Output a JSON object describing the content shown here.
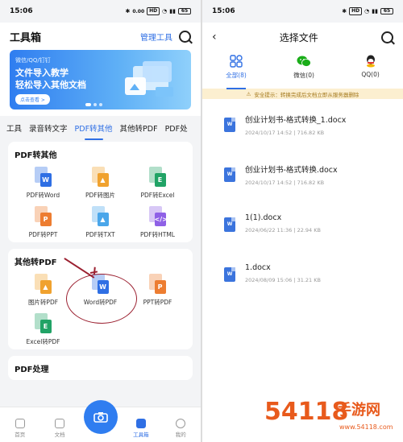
{
  "left": {
    "status": {
      "time": "15:06",
      "speed": "0.00\nKB/s",
      "battery": "65"
    },
    "header": {
      "title": "工具箱",
      "manage": "管理工具"
    },
    "banner": {
      "small": "微信/QQ/钉钉",
      "line1": "文件导入教学",
      "line2": "轻松导入其他文档",
      "button": "点击查看 >"
    },
    "tabs": [
      "工具",
      "录音转文字",
      "PDF转其他",
      "其他转PDF",
      "PDF处"
    ],
    "active_tab_index": 2,
    "section1": {
      "title": "PDF转其他",
      "items": [
        {
          "label": "PDF转Word",
          "badge": "W",
          "color": "#2f6fe4"
        },
        {
          "label": "PDF转图片",
          "badge": "▲",
          "color": "#f0a22f"
        },
        {
          "label": "PDF转Excel",
          "badge": "E",
          "color": "#21a366"
        },
        {
          "label": "PDF转PPT",
          "badge": "P",
          "color": "#ed7d31"
        },
        {
          "label": "PDF转TXT",
          "badge": "▲",
          "color": "#4aa6ea"
        },
        {
          "label": "PDF转HTML",
          "badge": "</>",
          "color": "#8f61e6"
        }
      ]
    },
    "section2": {
      "title": "其他转PDF",
      "items": [
        {
          "label": "图片转PDF",
          "badge": "▲",
          "color": "#f0a22f"
        },
        {
          "label": "Word转PDF",
          "badge": "W",
          "color": "#2f6fe4"
        },
        {
          "label": "PPT转PDF",
          "badge": "P",
          "color": "#ed7d31"
        },
        {
          "label": "Excel转PDF",
          "badge": "E",
          "color": "#21a366"
        }
      ]
    },
    "section3": {
      "title": "PDF处理"
    },
    "nav": {
      "home": "首页",
      "docs": "文档",
      "tools": "工具箱",
      "me": "我的"
    }
  },
  "right": {
    "status": {
      "time": "15:06",
      "battery": "65"
    },
    "header": {
      "title": "选择文件"
    },
    "tabs": [
      {
        "label": "全部(8)",
        "icon": "all-files-icon"
      },
      {
        "label": "微信(0)",
        "icon": "wechat-icon"
      },
      {
        "label": "QQ(0)",
        "icon": "qq-icon"
      }
    ],
    "notice": "安全提示：转换完成后文档立即从服务器删除",
    "files": [
      {
        "name": "创业计划书-格式转换_1.docx",
        "meta": "2024/10/17 14:52  |  716.82 KB"
      },
      {
        "name": "创业计划书-格式转换.docx",
        "meta": "2024/10/17 14:52  |  716.82 KB"
      },
      {
        "name": "1(1).docx",
        "meta": "2024/06/22 11:36  |  22.94 KB"
      },
      {
        "name": "1.docx",
        "meta": "2024/08/09 15:06  |  31.21 KB"
      }
    ]
  },
  "watermark": {
    "brand": "手游网",
    "domain": "www.54118.com",
    "number": "54118"
  },
  "colors": {
    "accent": "#2f6fe4",
    "annotation": "#9b2030"
  }
}
